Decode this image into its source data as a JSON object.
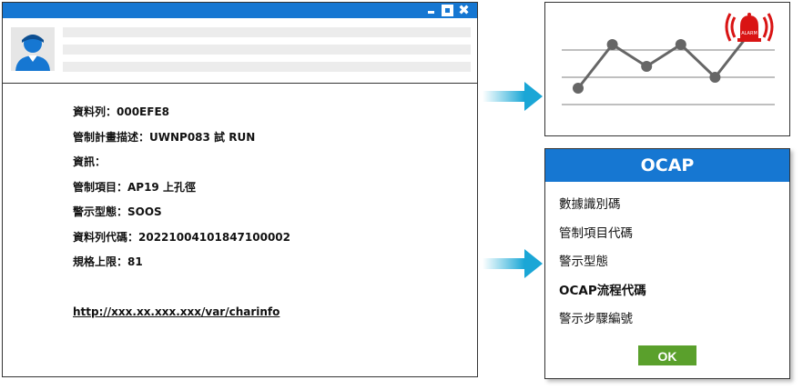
{
  "window": {
    "controls": {
      "close_glyph": "✖"
    }
  },
  "details": {
    "fields": [
      "資料列：000EFE8",
      "管制計畫描述：UWNP083 試 RUN",
      "資訊：",
      "管制項目：AP19 上孔徑",
      "警示型態：SOOS",
      "資料列代碼：20221004101847100002",
      "規格上限：81"
    ],
    "link": "http://xxx.xx.xxx.xxx/var/charinfo"
  },
  "chart_data": {
    "type": "line",
    "series": [
      {
        "values": [
          2,
          4,
          3,
          4,
          2.5,
          4.5
        ]
      }
    ],
    "alarm_label": "ALARM",
    "alarm_color": "#d91414",
    "line_color": "#666666",
    "alarm_point_color": "#ff0000"
  },
  "ocap": {
    "title": "OCAP",
    "items": [
      "數據識別碼",
      "管制項目代碼",
      "警示型態",
      "OCAP流程代碼",
      "警示步驟編號"
    ],
    "ok_label": "OK"
  },
  "colors": {
    "accent": "#1677d2",
    "ok": "#5aa02c",
    "arrow": "#22b0d8"
  }
}
